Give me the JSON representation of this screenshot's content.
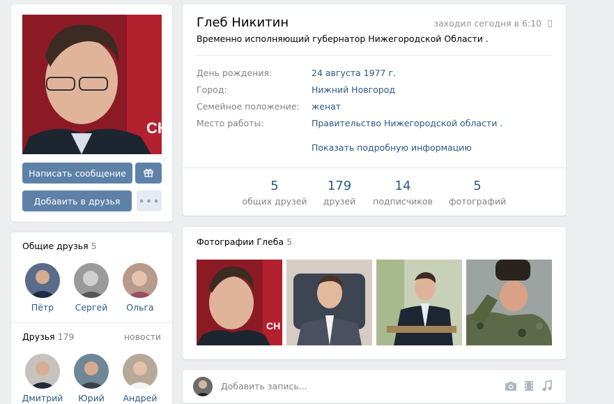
{
  "profile": {
    "name": "Глеб Никитин",
    "online": "заходил сегодня в 6:10",
    "status": "Временно исполняющий губернатор Нижегородской Области ."
  },
  "actions": {
    "message": "Написать сообщение",
    "add_friend": "Добавить в друзья"
  },
  "info": [
    {
      "label": "День рождения:",
      "value": "24 августа 1977 г."
    },
    {
      "label": "Город:",
      "value": "Нижний Новгород"
    },
    {
      "label": "Семейное положение:",
      "value": "женат"
    },
    {
      "label": "Место работы:",
      "value": "Правительство Нижегородской области ."
    }
  ],
  "show_more": "Показать подробную информацию",
  "counters": [
    {
      "num": "5",
      "label": "общих друзей"
    },
    {
      "num": "179",
      "label": "друзей"
    },
    {
      "num": "14",
      "label": "подписчиков"
    },
    {
      "num": "5",
      "label": "фотографий"
    }
  ],
  "mutual": {
    "title": "Общие друзья",
    "count": "5",
    "people": [
      "Пётр",
      "Сергей",
      "Ольга"
    ]
  },
  "friends": {
    "title": "Друзья",
    "count": "179",
    "news_link": "новости",
    "people": [
      "Дмитрий",
      "Юрий",
      "Андрей"
    ]
  },
  "photos": {
    "title": "Фотографии Глеба",
    "count": "5"
  },
  "post": {
    "placeholder": "Добавить запись..."
  },
  "icons": [
    "mobile-icon",
    "gift-icon",
    "more-icon",
    "camera-icon",
    "video-icon",
    "music-icon"
  ]
}
